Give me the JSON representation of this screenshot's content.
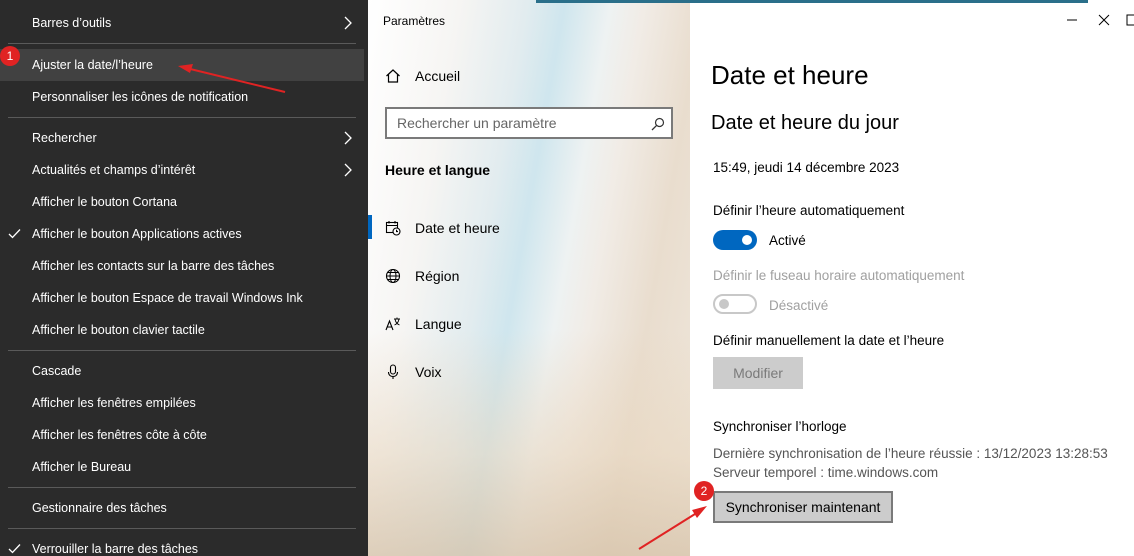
{
  "context_menu": {
    "items": [
      {
        "label": "Barres d’outils",
        "has_submenu": true,
        "checked": false
      },
      {
        "label": "Ajuster la date/l’heure",
        "has_submenu": false,
        "checked": false,
        "highlighted": true
      },
      {
        "label": "Personnaliser les icônes de notification",
        "has_submenu": false,
        "checked": false
      },
      {
        "label": "Rechercher",
        "has_submenu": true,
        "checked": false
      },
      {
        "label": "Actualités et champs d’intérêt",
        "has_submenu": true,
        "checked": false
      },
      {
        "label": "Afficher le bouton Cortana",
        "has_submenu": false,
        "checked": false
      },
      {
        "label": "Afficher le bouton Applications actives",
        "has_submenu": false,
        "checked": true
      },
      {
        "label": "Afficher les contacts sur la barre des tâches",
        "has_submenu": false,
        "checked": false
      },
      {
        "label": "Afficher le bouton Espace de travail Windows Ink",
        "has_submenu": false,
        "checked": false
      },
      {
        "label": "Afficher le bouton clavier tactile",
        "has_submenu": false,
        "checked": false
      },
      {
        "label": "Cascade",
        "has_submenu": false,
        "checked": false
      },
      {
        "label": "Afficher les fenêtres empilées",
        "has_submenu": false,
        "checked": false
      },
      {
        "label": "Afficher les fenêtres côte à côte",
        "has_submenu": false,
        "checked": false
      },
      {
        "label": "Afficher le Bureau",
        "has_submenu": false,
        "checked": false
      },
      {
        "label": "Gestionnaire des tâches",
        "has_submenu": false,
        "checked": false
      },
      {
        "label": "Verrouiller la barre des tâches",
        "has_submenu": false,
        "checked": true
      }
    ]
  },
  "settings": {
    "window_title": "Paramètres",
    "nav": {
      "home_label": "Accueil",
      "search_placeholder": "Rechercher un paramètre",
      "section_title": "Heure et langue",
      "items": [
        {
          "label": "Date et heure",
          "icon": "calendar-clock-icon",
          "active": true
        },
        {
          "label": "Région",
          "icon": "globe-icon",
          "active": false
        },
        {
          "label": "Langue",
          "icon": "language-icon",
          "active": false
        },
        {
          "label": "Voix",
          "icon": "microphone-icon",
          "active": false
        }
      ]
    },
    "content": {
      "page_title": "Date et heure",
      "subtitle": "Date et heure du jour",
      "current_datetime": "15:49, jeudi 14 décembre 2023",
      "auto_time_label": "Définir l’heure automatiquement",
      "auto_time_state": "Activé",
      "auto_timezone_label": "Définir le fuseau horaire automatiquement",
      "auto_timezone_state": "Désactivé",
      "manual_label": "Définir manuellement la date et l’heure",
      "modify_button": "Modifier",
      "sync_title": "Synchroniser l’horloge",
      "last_sync": "Dernière synchronisation de l’heure réussie : 13/12/2023 13:28:53",
      "time_server": "Serveur temporel : time.windows.com",
      "sync_button": "Synchroniser maintenant"
    }
  },
  "annotations": {
    "badge_1": "1",
    "badge_2": "2",
    "color": "#e02323"
  },
  "colors": {
    "menu_bg": "#2b2b2b",
    "menu_highlight": "#414141",
    "accent": "#0067c0"
  }
}
